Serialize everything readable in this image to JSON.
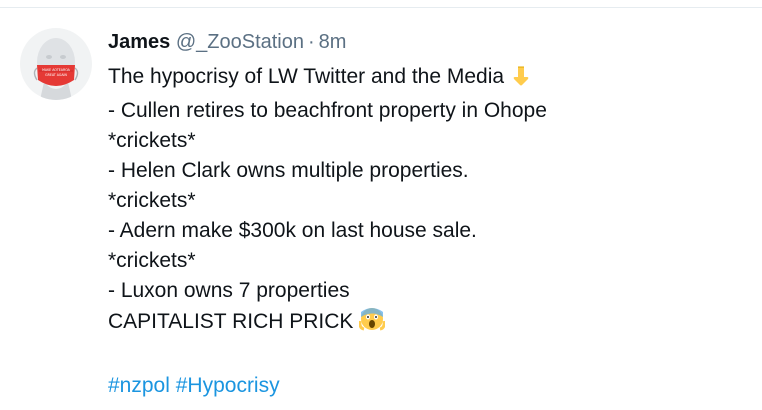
{
  "tweet": {
    "author": {
      "name": "James",
      "handle": "@_ZooStation",
      "separator": "·",
      "time": "8m",
      "mask_text": "MAKE AOTEAROA GREAT AGAIN"
    },
    "lines": [
      "The hypocrisy of LW Twitter and the Media",
      "- Cullen retires to beachfront property in Ohope",
      "*crickets*",
      "- Helen Clark owns multiple properties.",
      "*crickets*",
      "- Adern make $300k on last house sale.",
      "*crickets*",
      "- Luxon owns 7 properties",
      "CAPITALIST RICH PRICK"
    ],
    "icons": {
      "first_line": "pointing-down-icon",
      "last_line": "screaming-face-icon"
    },
    "hashtags": [
      "#nzpol",
      "#Hypocrisy"
    ]
  },
  "colors": {
    "text": "#0f1419",
    "muted": "#5b7083",
    "link": "#1b95e0",
    "mask": "#e53935"
  }
}
